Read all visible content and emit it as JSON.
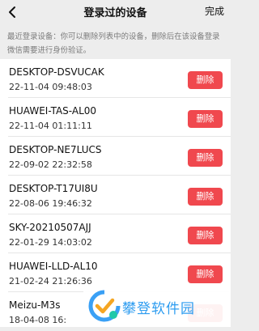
{
  "header": {
    "back_icon": "chevron-left-icon",
    "title": "登录过的设备",
    "done_label": "完成"
  },
  "notice": "最近登录设备：你可以删除列表中的设备，删除后在该设备登录微信需要进行身份验证。",
  "devices": [
    {
      "name": "DESKTOP-DSVUCAK",
      "time": "22-11-04 09:48:03",
      "delete_label": "删除"
    },
    {
      "name": "HUAWEI-TAS-AL00",
      "time": "22-11-04 01:11:11",
      "delete_label": "删除"
    },
    {
      "name": "DESKTOP-NE7LUCS",
      "time": "22-09-02 22:32:58",
      "delete_label": "删除"
    },
    {
      "name": "DESKTOP-T17UI8U",
      "time": "22-08-06 19:46:32",
      "delete_label": "删除"
    },
    {
      "name": "SKY-20210507AJJ",
      "time": "22-01-29 14:03:02",
      "delete_label": "删除"
    },
    {
      "name": "HUAWEI-LLD-AL10",
      "time": "21-02-24 21:26:36",
      "delete_label": "删除"
    },
    {
      "name": "Meizu-M3s",
      "time": "18-04-08 16:",
      "delete_label": "删除"
    }
  ],
  "watermark": {
    "text": "攀登软件园",
    "logo_icon": "checkmark-logo-icon"
  },
  "colors": {
    "background": "#ededed",
    "delete_button": "#f0484e",
    "watermark_blue": "#2d9cf0"
  }
}
